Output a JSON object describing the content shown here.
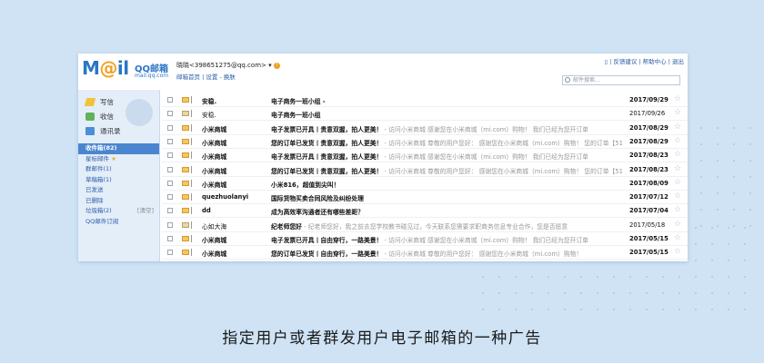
{
  "app": {
    "logo_text_left": "M",
    "logo_text_at": "@",
    "logo_text_right": "il",
    "logo_cn": "QQ邮箱",
    "logo_sub": "mail.qq.com"
  },
  "header": {
    "user": "晓晓<398651275@qq.com>",
    "user_dropdown": "▾",
    "warn_icon": "!",
    "user_links": "邮箱首页 | 设置 - 换肤",
    "top_links": "| 反馈建议 | 帮助中心 | 退出",
    "search_placeholder": "邮件搜索..."
  },
  "sidebar": {
    "quick": [
      {
        "label": "写信",
        "icon": "pen-icon"
      },
      {
        "label": "收信",
        "icon": "inbox-icon"
      },
      {
        "label": "通讯录",
        "icon": "contacts-icon"
      }
    ],
    "folders": [
      {
        "label": "收件箱(82)",
        "active": true,
        "extra": ""
      },
      {
        "label": "星标邮件",
        "star": "★",
        "extra": ""
      },
      {
        "label": "群邮件(1)",
        "extra": ""
      },
      {
        "label": "草稿箱(1)",
        "extra": ""
      },
      {
        "label": "已发送",
        "extra": ""
      },
      {
        "label": "已删除",
        "extra": ""
      },
      {
        "label": "垃圾箱(2)",
        "extra": "[清空]"
      },
      {
        "label": "QQ邮件订阅",
        "extra": ""
      }
    ]
  },
  "emails": [
    {
      "sender": "安稳.",
      "subject": "电子商务一班小组 -",
      "preview": "",
      "date": "2017/09/29",
      "unread": true
    },
    {
      "sender": "安稳.",
      "subject": "电子商务一班小组",
      "preview": "",
      "date": "2017/09/26",
      "unread": false
    },
    {
      "sender": "小米商城",
      "subject": "电子发票已开具丨贵意双握，拍人更美！",
      "preview": " - 访问小米商城 感谢您在小米商城（mi.com）购物！ 我们已经为您开订单",
      "date": "2017/08/29",
      "unread": true
    },
    {
      "sender": "小米商城",
      "subject": "您的订单已发货丨贵意双握，拍人更美！",
      "preview": " - 访问小米商城 尊敬的用户您好： 感谢您在小米商城（mi.com）购物！ 您的订单【51708283...",
      "date": "2017/08/29",
      "unread": true
    },
    {
      "sender": "小米商城",
      "subject": "电子发票已开具丨贵意双握，拍人更美！",
      "preview": " - 访问小米商城 感谢您在小米商城（mi.com）购物！ 我们已经为您开订单",
      "date": "2017/08/23",
      "unread": true
    },
    {
      "sender": "小米商城",
      "subject": "您的订单已发货丨贵意双握，拍人更美！",
      "preview": " - 访问小米商城 尊敬的用户您好： 感谢您在小米商城（mi.com）购物！ 您的订单【51708231...",
      "date": "2017/08/23",
      "unread": true
    },
    {
      "sender": "小米商城",
      "subject": "小米816，超值到尖叫！",
      "preview": "",
      "date": "2017/08/09",
      "unread": true
    },
    {
      "sender": "quezhuolanyi",
      "subject": "国际货物买卖合同风险及纠纷处理",
      "preview": "",
      "date": "2017/07/12",
      "unread": true
    },
    {
      "sender": "dd",
      "subject": "成为高效率沟通者还有哪些差距？",
      "preview": "",
      "date": "2017/07/04",
      "unread": true
    },
    {
      "sender": "心如大海",
      "subject": "纪老师您好",
      "preview": " - 纪老师您好，我之前去您学校教书碰见过，今天联系您需要求职商务信息专业合作，您是否愿意",
      "date": "2017/05/18",
      "unread": false
    },
    {
      "sender": "小米商城",
      "subject": "电子发票已开具丨自由穿行，一路美景！",
      "preview": " - 访问小米商城 感谢您在小米商城（mi.com）购物！ 我们已经为您开订单",
      "date": "2017/05/15",
      "unread": true
    },
    {
      "sender": "小米商城",
      "subject": "您的订单已发货丨自由穿行，一路美景！",
      "preview": " - 访问小米商城 尊敬的用户您好： 感谢您在小米商城（mi.com）购物！",
      "date": "2017/05/15",
      "unread": true
    }
  ],
  "star_glyph": "☆",
  "caption": "指定用户或者群发用户电子邮箱的一种广告",
  "colors": {
    "background": "#cfe3f5",
    "brand_blue": "#2a76c6",
    "active_folder": "#4a86cf"
  }
}
